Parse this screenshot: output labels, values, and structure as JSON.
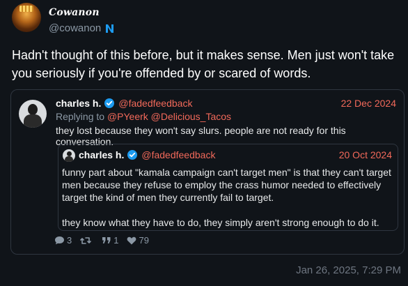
{
  "author": {
    "display_name": "Cowanon",
    "handle": "@cowanon"
  },
  "post": {
    "text": "Hadn't thought of this before, but it makes sense. Men just won't take you seriously if you're offended by or scared of words.",
    "timestamp": "Jan 26, 2025, 7:29 PM"
  },
  "quoted": {
    "name": "charles h.",
    "handle": "@fadedfeedback",
    "date": "22 Dec 2024",
    "replying_label": "Replying to",
    "replying_mentions": "@PYeerk @Delicious_Tacos",
    "text": "they lost because they won't say slurs. people are not ready for this conversation.",
    "stats": {
      "replies": "3",
      "retweets": "",
      "quotes": "1",
      "likes": "79"
    },
    "inner": {
      "name": "charles h.",
      "handle": "@fadedfeedback",
      "date": "20 Oct 2024",
      "paragraph1": "funny part about \"kamala campaign can't target men\" is that they can't target men because they refuse to employ the crass humor needed to effectively target the kind of men they currently fail to target.",
      "paragraph2": "they know what they have to do, they simply aren't strong enough to do it."
    }
  },
  "colors": {
    "background": "#101419",
    "accent": "#f2695a",
    "muted": "#8b98a5",
    "verified": "#1d9bf0"
  },
  "icons": [
    "n-badge-icon",
    "verified-icon",
    "reply-icon",
    "retweet-icon",
    "quote-icon",
    "heart-icon"
  ]
}
